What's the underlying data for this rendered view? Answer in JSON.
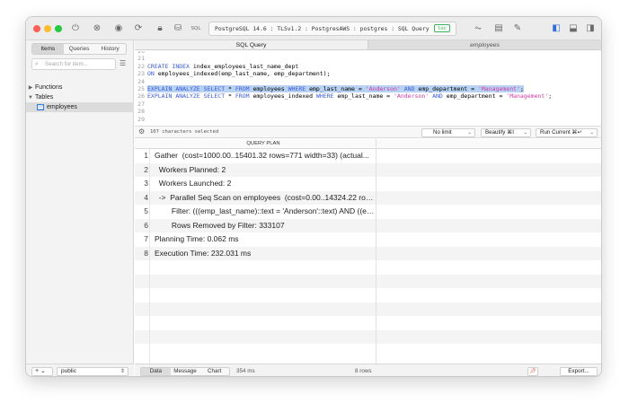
{
  "toolbar": {
    "connection": "PostgreSQL 14.6 : TLSv1.2 : PostgresAWS : postgres : SQL Query",
    "connection_badge": "loc",
    "sql_label": "SQL"
  },
  "sidebar": {
    "tabs": [
      "Items",
      "Queries",
      "History"
    ],
    "search_placeholder": "Search for item...",
    "tree": {
      "functions": "Functions",
      "tables": "Tables",
      "employees": "employees"
    },
    "add_label": "+ ⌄",
    "schema": "public"
  },
  "tabs": {
    "sql_query": "SQL Query",
    "employees": "employees"
  },
  "editor": {
    "lines": [
      {
        "n": "20",
        "text": ""
      },
      {
        "n": "21",
        "text": ""
      },
      {
        "n": "22",
        "text": "CREATE INDEX index_employees_last_name_dept"
      },
      {
        "n": "23",
        "text": "ON employees_indexed(emp_last_name, emp_department);"
      },
      {
        "n": "24",
        "text": ""
      },
      {
        "n": "25",
        "text": "EXPLAIN ANALYZE SELECT * FROM employees WHERE emp_last_name = 'Anderson' AND emp_department = 'Management';"
      },
      {
        "n": "26",
        "text": "EXPLAIN ANALYZE SELECT * FROM employees_indexed WHERE emp_last_name = 'Anderson' AND emp_department = 'Management';"
      },
      {
        "n": "27",
        "text": ""
      },
      {
        "n": "28",
        "text": ""
      },
      {
        "n": "29",
        "text": ""
      }
    ],
    "selected_count": "107 characters selected",
    "limit": "No limit",
    "beautify": "Beautify ⌘I",
    "run": "Run Current ⌘↵"
  },
  "results": {
    "column": "QUERY PLAN",
    "rows": [
      {
        "n": "1",
        "text": "Gather  (cost=1000.00..15401.32 rows=771 width=33) (actual..."
      },
      {
        "n": "2",
        "text": "  Workers Planned: 2"
      },
      {
        "n": "3",
        "text": "  Workers Launched: 2"
      },
      {
        "n": "4",
        "text": "  ->  Parallel Seq Scan on employees  (cost=0.00..14324.22 row..."
      },
      {
        "n": "5",
        "text": "        Filter: (((emp_last_name)::text = 'Anderson'::text) AND ((em..."
      },
      {
        "n": "6",
        "text": "        Rows Removed by Filter: 333107"
      },
      {
        "n": "7",
        "text": "Planning Time: 0.062 ms"
      },
      {
        "n": "8",
        "text": "Execution Time: 232.031 ms"
      }
    ]
  },
  "bottombar": {
    "tabs": [
      "Data",
      "Message",
      "Chart"
    ],
    "time": "354 ms",
    "rows": "8 rows",
    "export": "Export..."
  }
}
